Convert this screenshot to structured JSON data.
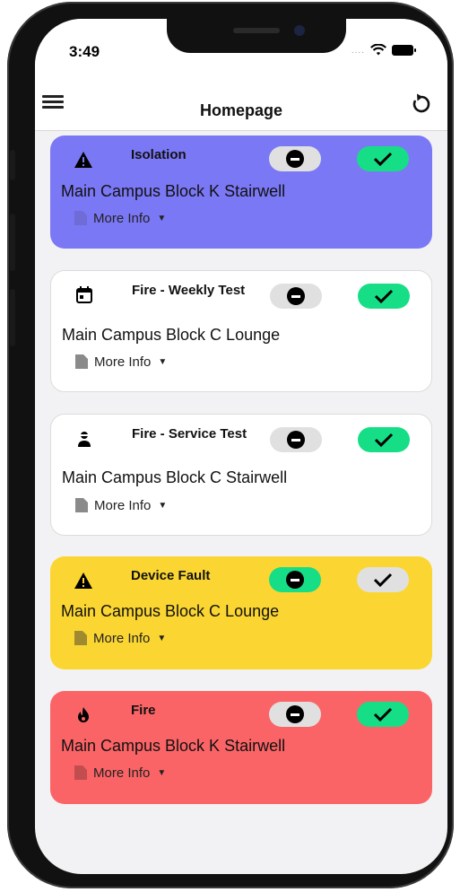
{
  "status_bar": {
    "time": "3:49",
    "signal": "....",
    "icons": [
      "wifi-icon",
      "battery-icon"
    ]
  },
  "header": {
    "title": "Homepage",
    "left_icon": "menu-icon",
    "right_icon": "refresh-icon"
  },
  "colors": {
    "isolation": "#7b78f5",
    "device_fault": "#fbd632",
    "fire": "#fb6466",
    "ack_green": "#16de86",
    "pill_grey": "#e0e0e0"
  },
  "alerts": [
    {
      "type": "Isolation",
      "icon": "warning-icon",
      "location": "Main Campus Block K Stairwell",
      "more_info": "More Info",
      "dismiss_color": "#e0e0e0",
      "ack_color": "#16de86"
    },
    {
      "type": "Fire - Weekly Test",
      "icon": "calendar-icon",
      "location": "Main Campus Block C Lounge",
      "more_info": "More Info",
      "dismiss_color": "#e0e0e0",
      "ack_color": "#16de86"
    },
    {
      "type": "Fire - Service Test",
      "icon": "technician-icon",
      "location": "Main Campus Block C Stairwell",
      "more_info": "More Info",
      "dismiss_color": "#e0e0e0",
      "ack_color": "#16de86"
    },
    {
      "type": "Device Fault",
      "icon": "warning-icon",
      "location": "Main Campus Block C Lounge",
      "more_info": "More Info",
      "dismiss_color": "#16de86",
      "ack_color": "#e0e0e0"
    },
    {
      "type": "Fire",
      "icon": "flame-icon",
      "location": "Main Campus Block K Stairwell",
      "more_info": "More Info",
      "dismiss_color": "#e0e0e0",
      "ack_color": "#16de86"
    }
  ]
}
